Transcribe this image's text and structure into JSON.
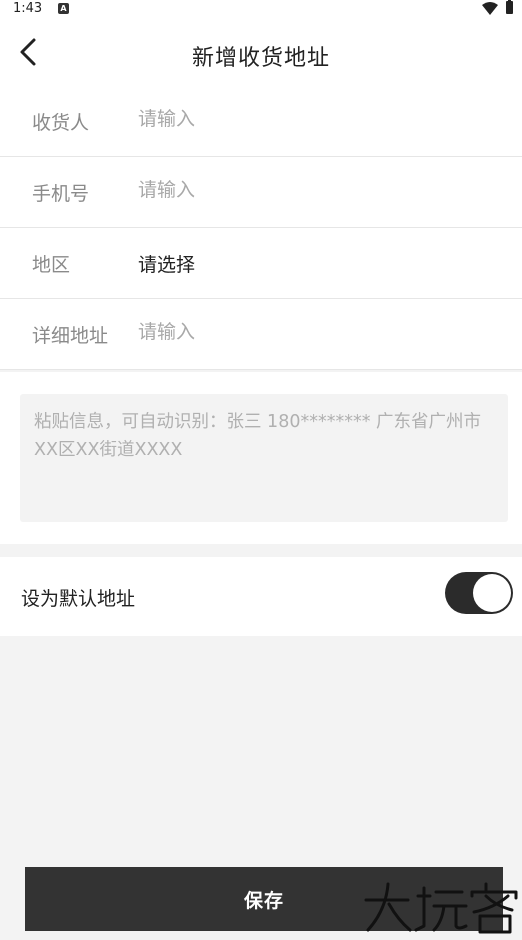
{
  "status": {
    "time": "1:43",
    "notification_glyph": "A",
    "icons": [
      "notification-a-icon",
      "wifi-icon",
      "battery-icon"
    ]
  },
  "header": {
    "title": "新增收货地址",
    "back_icon": "back-arrow-icon"
  },
  "form": {
    "recipient": {
      "label": "收货人",
      "placeholder": "请输入",
      "value": ""
    },
    "phone": {
      "label": "手机号",
      "placeholder": "请输入",
      "value": ""
    },
    "region": {
      "label": "地区",
      "value": "请选择"
    },
    "detail": {
      "label": "详细地址",
      "placeholder": "请输入",
      "value": ""
    }
  },
  "paste": {
    "placeholder": "粘贴信息，可自动识别：张三 180******** 广东省广州市XX区XX街道XXXX"
  },
  "default_address": {
    "label": "设为默认地址",
    "enabled": true
  },
  "save_label": "保存",
  "colors": {
    "accent": "#333333",
    "background": "#f3f3f3",
    "placeholder": "#a8a8a8"
  },
  "watermark": {
    "text": "大玩客"
  }
}
